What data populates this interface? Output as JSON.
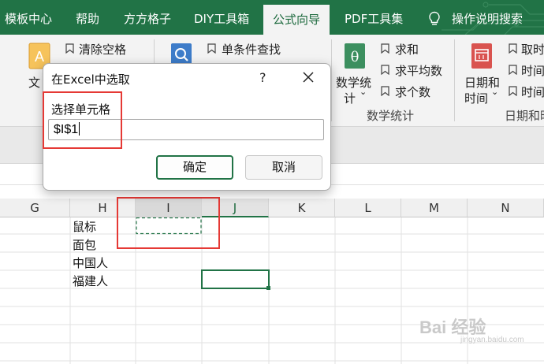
{
  "tabs": [
    "模板中心",
    "帮助",
    "方方格子",
    "DIY工具箱",
    "公式向导",
    "PDF工具集",
    "操作说明搜索"
  ],
  "active_tab": "公式向导",
  "ribbon": {
    "group1": {
      "big_label": "文",
      "items": [
        "清除空格"
      ]
    },
    "group2": {
      "items": [
        "单条件查找"
      ]
    },
    "math": {
      "big_label_1": "数学统",
      "big_label_2": "计",
      "items": [
        "求和",
        "求平均数",
        "求个数"
      ],
      "group_label": "数学统计"
    },
    "date": {
      "big_label_1": "日期和",
      "big_label_2": "时间",
      "items": [
        "取时",
        "时间",
        "时间"
      ],
      "group_label": "日期和时"
    }
  },
  "dialog": {
    "title": "在Excel中选取",
    "help": "?",
    "label": "选择单元格",
    "value": "$I$1",
    "ok": "确定",
    "cancel": "取消"
  },
  "columns": [
    "G",
    "H",
    "I",
    "J",
    "K",
    "L",
    "M",
    "N"
  ],
  "cells": [
    "鼠标",
    "面包",
    "中国人",
    "福建人"
  ],
  "watermark": {
    "main": "Bai 经验",
    "sub": "jingyan.baidu.com"
  },
  "colors": {
    "excel_green": "#217346",
    "highlight_red": "#e53935"
  }
}
